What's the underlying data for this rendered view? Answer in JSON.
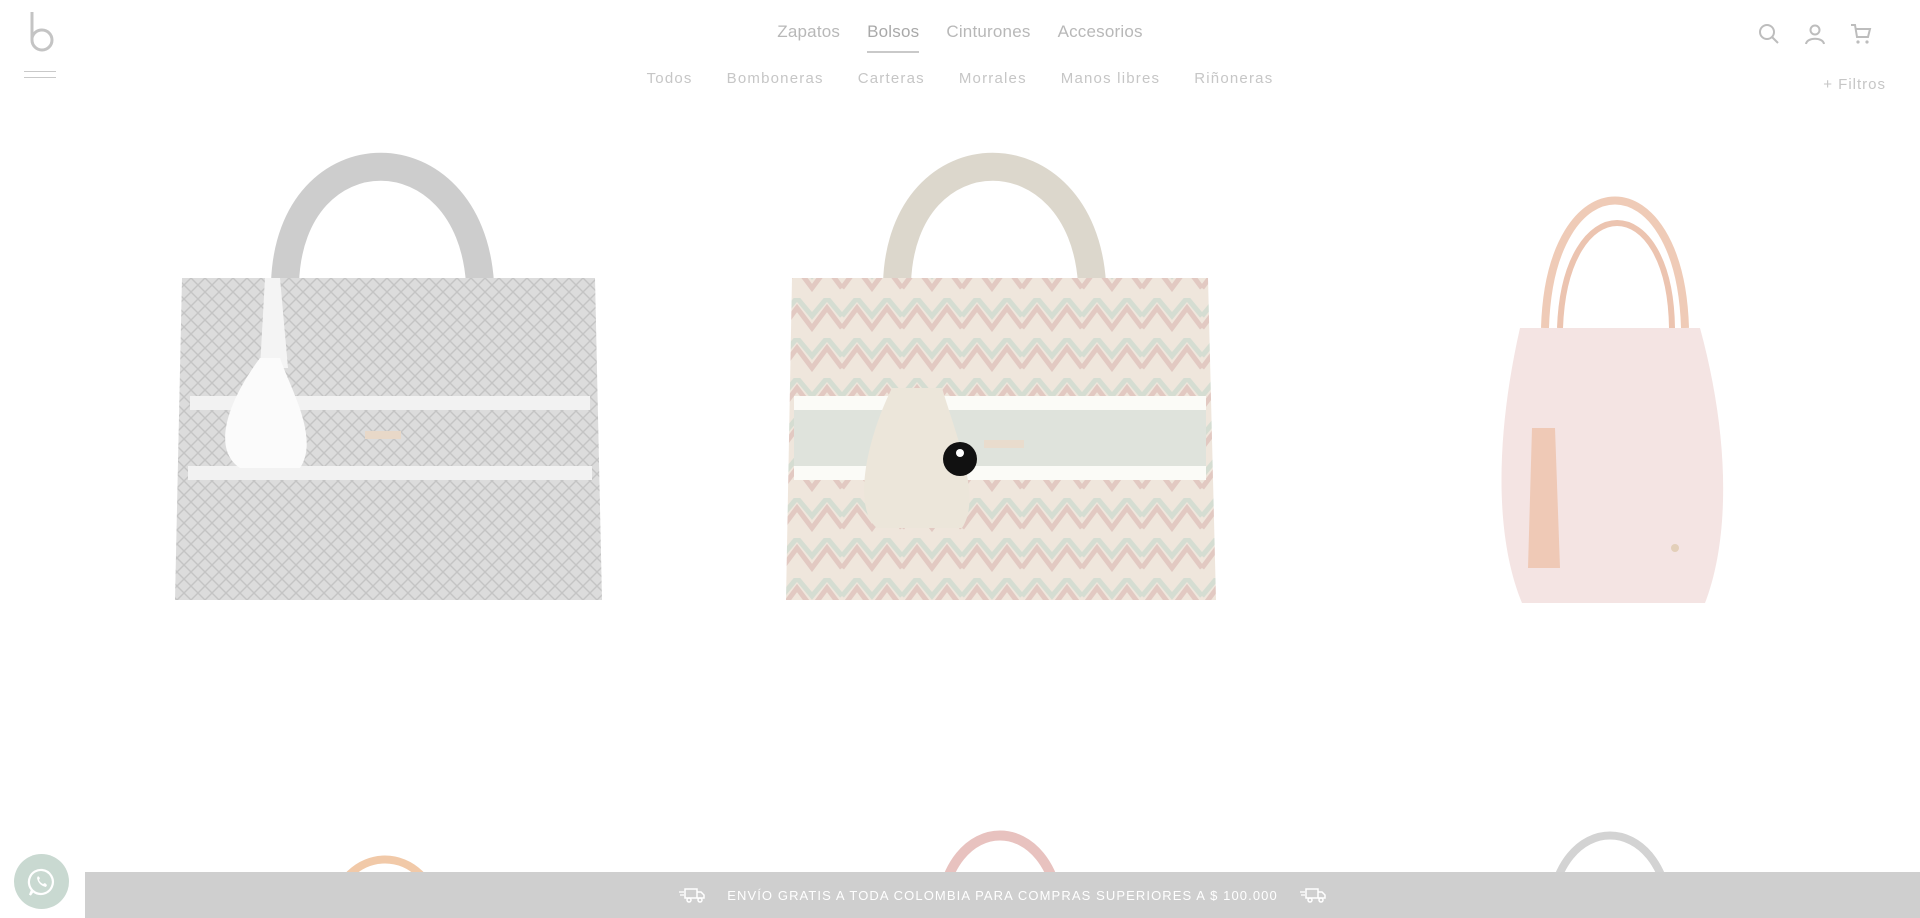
{
  "header": {
    "main_nav": [
      "Zapatos",
      "Bolsos",
      "Cinturones",
      "Accesorios"
    ],
    "active_main": "Bolsos",
    "sub_nav": [
      "Todos",
      "Bomboneras",
      "Carteras",
      "Morrales",
      "Manos libres",
      "Riñoneras"
    ],
    "filters_label": "+ Filtros",
    "icons": [
      "search-icon",
      "user-icon",
      "cart-icon"
    ]
  },
  "products": [
    {
      "name": "gray-diamond-tote",
      "colors": [
        "#c9c9c9",
        "#e9e9e9",
        "#ffffff"
      ]
    },
    {
      "name": "chevron-pattern-tote",
      "colors": [
        "#e3cfc6",
        "#d6ddd2",
        "#ecdcc8"
      ]
    },
    {
      "name": "pink-bucket-bag",
      "colors": [
        "#f4e2e1",
        "#efc7b4"
      ]
    },
    {
      "name": "orange-handle-bag",
      "colors": [
        "#f1c9a8"
      ]
    },
    {
      "name": "rose-handle-bag",
      "colors": [
        "#e8c2bf"
      ]
    },
    {
      "name": "gray-handle-bag",
      "colors": [
        "#d3d3d3"
      ]
    }
  ],
  "shipping_banner": {
    "text": "ENVÍO GRATIS A TODA COLOMBIA PARA COMPRAS SUPERIORES A $ 100.000"
  },
  "colors": {
    "accent": "#c9c9c9",
    "banner": "#cfcfcf",
    "whatsapp": "#c9d9d1"
  }
}
